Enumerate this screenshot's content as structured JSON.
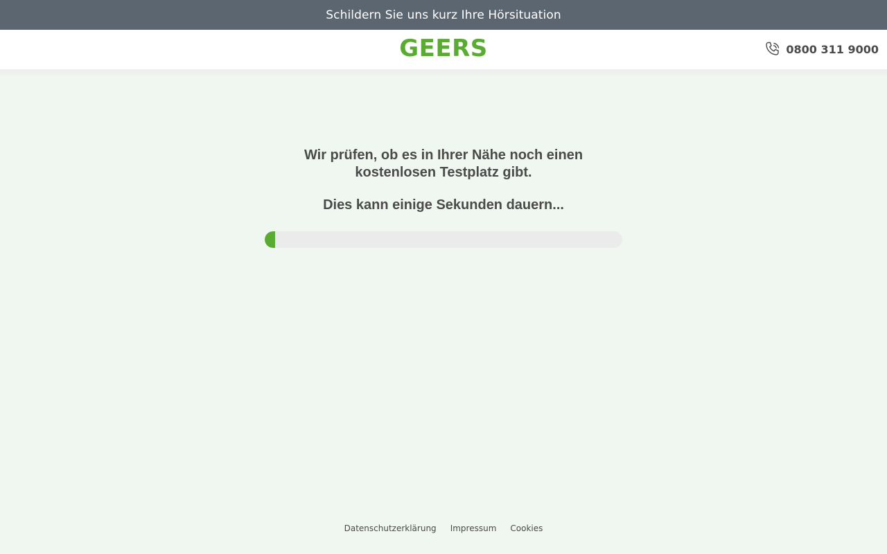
{
  "colors": {
    "brand": "#5aab32",
    "topbar_bg": "#5b6670",
    "page_bg": "#f0f7f0",
    "progress_track": "#ebebeb",
    "text": "#4a4a4a"
  },
  "topbar": {
    "text": "Schildern Sie uns kurz Ihre Hörsituation"
  },
  "header": {
    "logo": "GEERS",
    "phone": {
      "icon": "phone-icon",
      "number": "0800 311 9000"
    }
  },
  "main": {
    "headline": "Wir prüfen, ob es in Ihrer Nähe noch einen kostenlosen Testplatz gibt.",
    "subline": "Dies kann einige Sekunden dauern...",
    "progress": 0.03
  },
  "footer": {
    "links": [
      "Datenschutzerklärung",
      "Impressum",
      "Cookies"
    ]
  }
}
